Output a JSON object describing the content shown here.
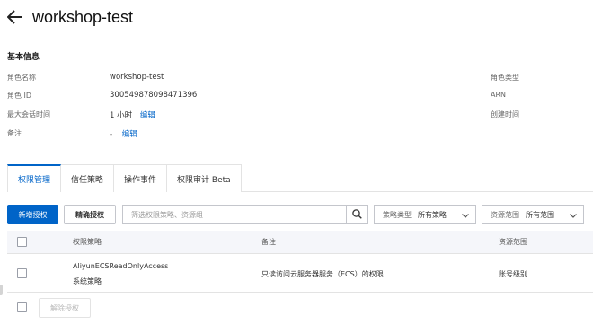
{
  "header": {
    "title": "workshop-test"
  },
  "basic_info": {
    "section_title": "基本信息",
    "role_name_label": "角色名称",
    "role_name_value": "workshop-test",
    "role_id_label": "角色 ID",
    "role_id_value": "300549878098471396",
    "max_session_label": "最大会话时间",
    "max_session_value": "1 小时",
    "max_session_edit": "编辑",
    "remark_label": "备注",
    "remark_value": "-",
    "remark_edit": "编辑",
    "role_type_label": "角色类型",
    "arn_label": "ARN",
    "created_label": "创建时间"
  },
  "tabs": [
    {
      "label": "权限管理",
      "active": true
    },
    {
      "label": "信任策略",
      "active": false
    },
    {
      "label": "操作事件",
      "active": false
    },
    {
      "label": "权限审计 Beta",
      "active": false
    }
  ],
  "toolbar": {
    "add_button": "新增授权",
    "precise_button": "精确授权",
    "search_placeholder": "筛选权限策略、资源组",
    "policy_type_label": "策略类型",
    "policy_type_value": "所有策略",
    "scope_label": "资源范围",
    "scope_value": "所有范围"
  },
  "table": {
    "columns": [
      "权限策略",
      "备注",
      "资源范围"
    ],
    "rows": [
      {
        "policy_name": "AliyunECSReadOnlyAccess",
        "policy_type": "系统策略",
        "remark": "只读访问云服务器服务（ECS）的权限",
        "scope": "账号级别"
      }
    ]
  },
  "footer": {
    "revoke_button": "解除授权"
  },
  "colors": {
    "primary": "#0064c8",
    "header_bg": "#f5f6fa",
    "border": "#e3e3e3"
  },
  "icons": [
    "arrow-left-icon",
    "search-icon",
    "chevron-down-icon"
  ]
}
